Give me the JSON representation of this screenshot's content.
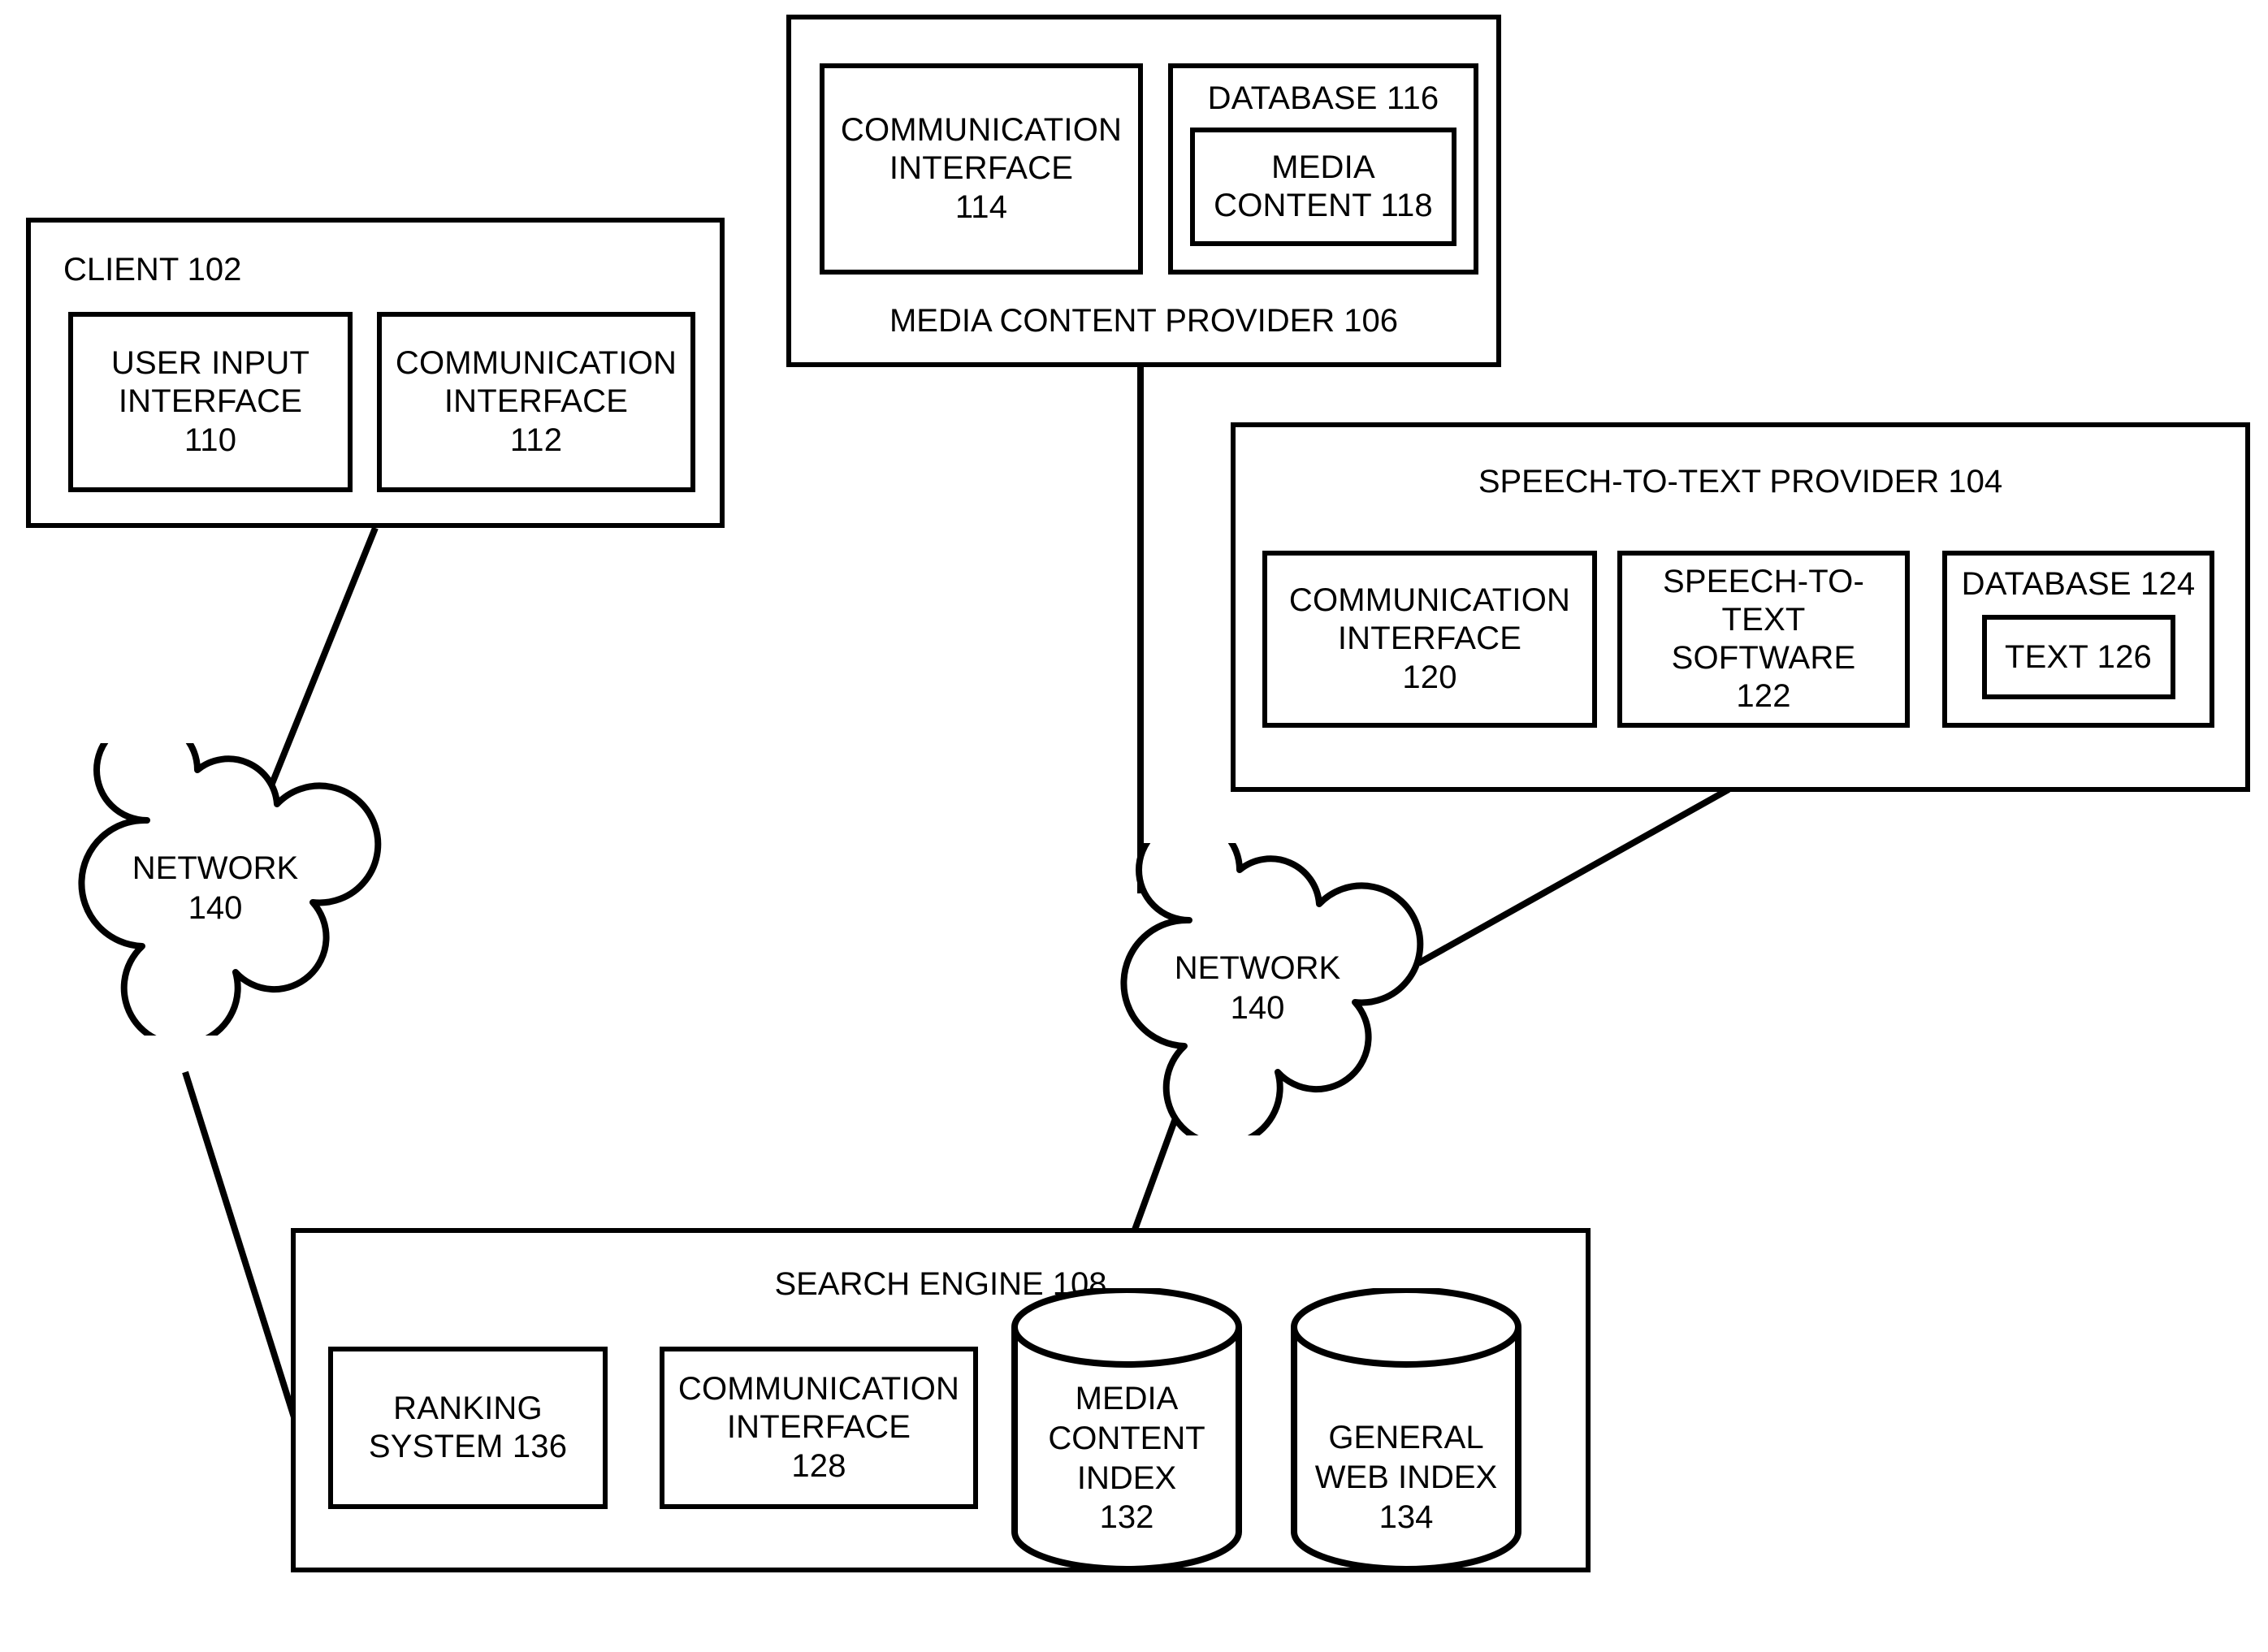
{
  "figure": {
    "type": "system-block-diagram",
    "background": "#ffffff",
    "stroke_color": "#000000"
  },
  "client": {
    "title": "CLIENT 102",
    "modules": [
      {
        "label": "USER INPUT\nINTERFACE\n110"
      },
      {
        "label": "COMMUNICATION\nINTERFACE\n112"
      }
    ]
  },
  "media_content_provider": {
    "title": "MEDIA CONTENT PROVIDER 106",
    "communication_interface": "COMMUNICATION\nINTERFACE\n114",
    "database": {
      "title": "DATABASE 116",
      "content": "MEDIA\nCONTENT 118"
    }
  },
  "speech_to_text_provider": {
    "title": "SPEECH-TO-TEXT PROVIDER 104",
    "communication_interface": "COMMUNICATION\nINTERFACE\n120",
    "software": "SPEECH-TO-\nTEXT\nSOFTWARE\n122",
    "database": {
      "title": "DATABASE 124",
      "content": "TEXT 126"
    }
  },
  "networks": [
    {
      "label": "NETWORK\n140"
    },
    {
      "label": "NETWORK\n140"
    }
  ],
  "search_engine": {
    "title": "SEARCH ENGINE 108",
    "modules": [
      {
        "label": "RANKING\nSYSTEM 136"
      },
      {
        "label": "COMMUNICATION\nINTERFACE\n128"
      }
    ],
    "indexes": [
      {
        "label": "MEDIA\nCONTENT\nINDEX\n132"
      },
      {
        "label": "GENERAL\nWEB INDEX\n134"
      }
    ]
  }
}
